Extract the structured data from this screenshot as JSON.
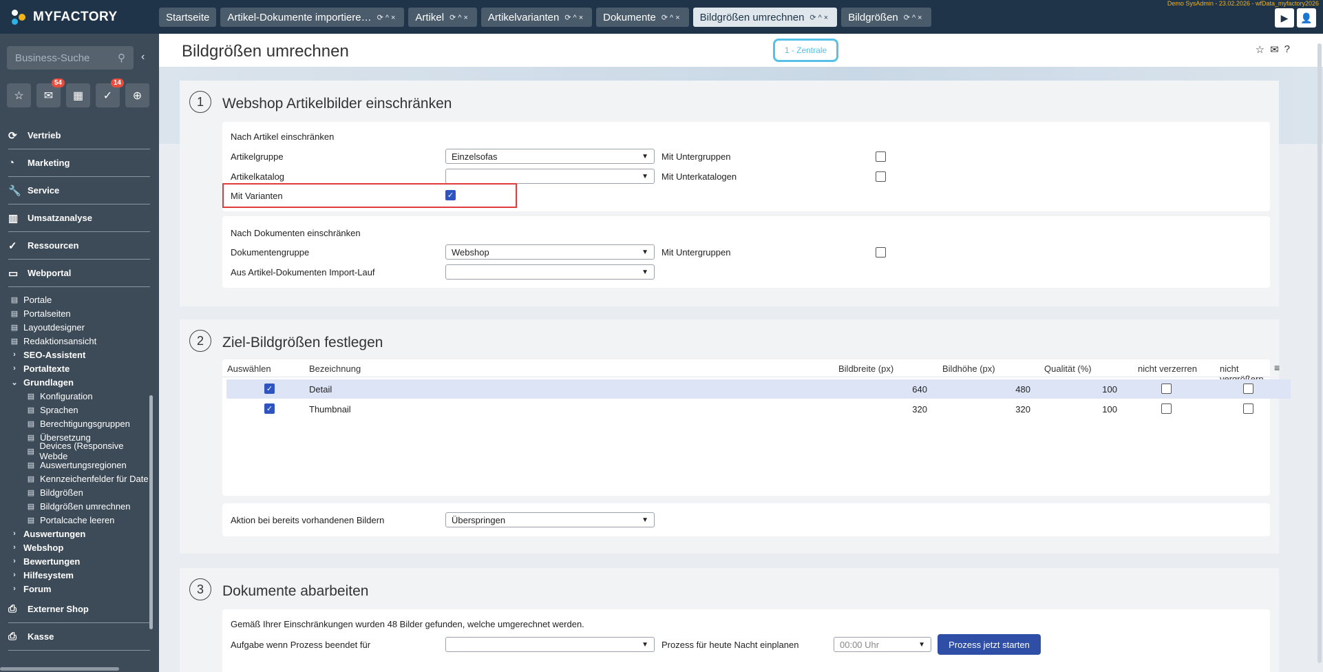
{
  "app": {
    "name": "MYFACTORY",
    "user_info": "Demo SysAdmin - 23.02.2026 - wfData_myfactory2026"
  },
  "tabs": [
    {
      "label": "Startseite",
      "active": false
    },
    {
      "label": "Artikel-Dokumente importiere…",
      "active": false
    },
    {
      "label": "Artikel",
      "active": false
    },
    {
      "label": "Artikelvarianten",
      "active": false
    },
    {
      "label": "Dokumente",
      "active": false
    },
    {
      "label": "Bildgrößen umrechnen",
      "active": true
    },
    {
      "label": "Bildgrößen",
      "active": false
    }
  ],
  "sidebar": {
    "search_placeholder": "Business-Suche",
    "badges": {
      "mail": "54",
      "tasks": "14"
    },
    "main_items": [
      {
        "label": "Vertrieb",
        "icon": "refresh-icon"
      },
      {
        "label": "Marketing",
        "icon": "pie-chart-icon"
      },
      {
        "label": "Service",
        "icon": "wrench-icon"
      },
      {
        "label": "Umsatzanalyse",
        "icon": "bar-chart-icon"
      },
      {
        "label": "Ressourcen",
        "icon": "check-circle-icon"
      },
      {
        "label": "Webportal",
        "icon": "browser-icon"
      }
    ],
    "webportal_items": [
      {
        "label": "Portale",
        "type": "leaf",
        "level": 1
      },
      {
        "label": "Portalseiten",
        "type": "leaf",
        "level": 1
      },
      {
        "label": "Layoutdesigner",
        "type": "leaf",
        "level": 1
      },
      {
        "label": "Redaktionsansicht",
        "type": "leaf",
        "level": 1
      },
      {
        "label": "SEO-Assistent",
        "type": "collapsed",
        "level": 1
      },
      {
        "label": "Portaltexte",
        "type": "collapsed",
        "level": 1
      },
      {
        "label": "Grundlagen",
        "type": "expanded",
        "level": 1
      },
      {
        "label": "Konfiguration",
        "type": "leaf",
        "level": 2
      },
      {
        "label": "Sprachen",
        "type": "leaf",
        "level": 2
      },
      {
        "label": "Berechtigungsgruppen",
        "type": "leaf",
        "level": 2
      },
      {
        "label": "Übersetzung",
        "type": "leaf",
        "level": 2
      },
      {
        "label": "Devices (Responsive Webde",
        "type": "leaf",
        "level": 2
      },
      {
        "label": "Auswertungsregionen",
        "type": "leaf",
        "level": 2
      },
      {
        "label": "Kennzeichenfelder für Date",
        "type": "leaf",
        "level": 2
      },
      {
        "label": "Bildgrößen",
        "type": "leaf",
        "level": 2
      },
      {
        "label": "Bildgrößen umrechnen",
        "type": "leaf",
        "level": 2
      },
      {
        "label": "Portalcache leeren",
        "type": "leaf",
        "level": 2
      },
      {
        "label": "Auswertungen",
        "type": "collapsed",
        "level": 1
      },
      {
        "label": "Webshop",
        "type": "collapsed",
        "level": 1
      },
      {
        "label": "Bewertungen",
        "type": "collapsed",
        "level": 1
      },
      {
        "label": "Hilfesystem",
        "type": "collapsed",
        "level": 1
      },
      {
        "label": "Forum",
        "type": "collapsed",
        "level": 1
      }
    ],
    "bottom_items": [
      {
        "label": "Externer Shop",
        "icon": "printer-icon"
      },
      {
        "label": "Kasse",
        "icon": "printer-icon"
      }
    ]
  },
  "page": {
    "title": "Bildgrößen umrechnen",
    "mandant": "1 - Zentrale"
  },
  "section1": {
    "step": "1",
    "title": "Webshop Artikelbilder einschränken",
    "artikel_card_title": "Nach Artikel einschränken",
    "artikelgruppe_label": "Artikelgruppe",
    "artikelgruppe_value": "Einzelsofas",
    "mit_untergruppen_label": "Mit Untergruppen",
    "artikelkatalog_label": "Artikelkatalog",
    "artikelkatalog_value": "",
    "mit_unterkatalogen_label": "Mit Unterkatalogen",
    "mit_varianten_label": "Mit Varianten",
    "mit_varianten_checked": true,
    "dokumente_card_title": "Nach Dokumenten einschränken",
    "dokumentengruppe_label": "Dokumentengruppe",
    "dokumentengruppe_value": "Webshop",
    "dok_mit_untergruppen_label": "Mit Untergruppen",
    "importlauf_label": "Aus Artikel-Dokumenten Import-Lauf",
    "importlauf_value": ""
  },
  "section2": {
    "step": "2",
    "title": "Ziel-Bildgrößen festlegen",
    "columns": [
      "Auswählen",
      "Bezeichnung",
      "Bildbreite (px)",
      "Bildhöhe (px)",
      "Qualität (%)",
      "nicht verzerren",
      "nicht vergrößern"
    ],
    "rows": [
      {
        "selected": true,
        "name": "Detail",
        "width": "640",
        "height": "480",
        "quality": "100",
        "no_distort": false,
        "no_enlarge": false
      },
      {
        "selected": true,
        "name": "Thumbnail",
        "width": "320",
        "height": "320",
        "quality": "100",
        "no_distort": false,
        "no_enlarge": false
      }
    ],
    "aktion_label": "Aktion bei bereits vorhandenen Bildern",
    "aktion_value": "Überspringen"
  },
  "section3": {
    "step": "3",
    "title": "Dokumente abarbeiten",
    "info_text": "Gemäß Ihrer Einschränkungen wurden 48 Bilder gefunden, welche umgerechnet werden.",
    "aufgabe_label": "Aufgabe wenn Prozess beendet für",
    "aufgabe_value": "",
    "nacht_label": "Prozess für heute Nacht einplanen",
    "nacht_value": "00:00 Uhr",
    "start_button": "Prozess jetzt starten"
  }
}
